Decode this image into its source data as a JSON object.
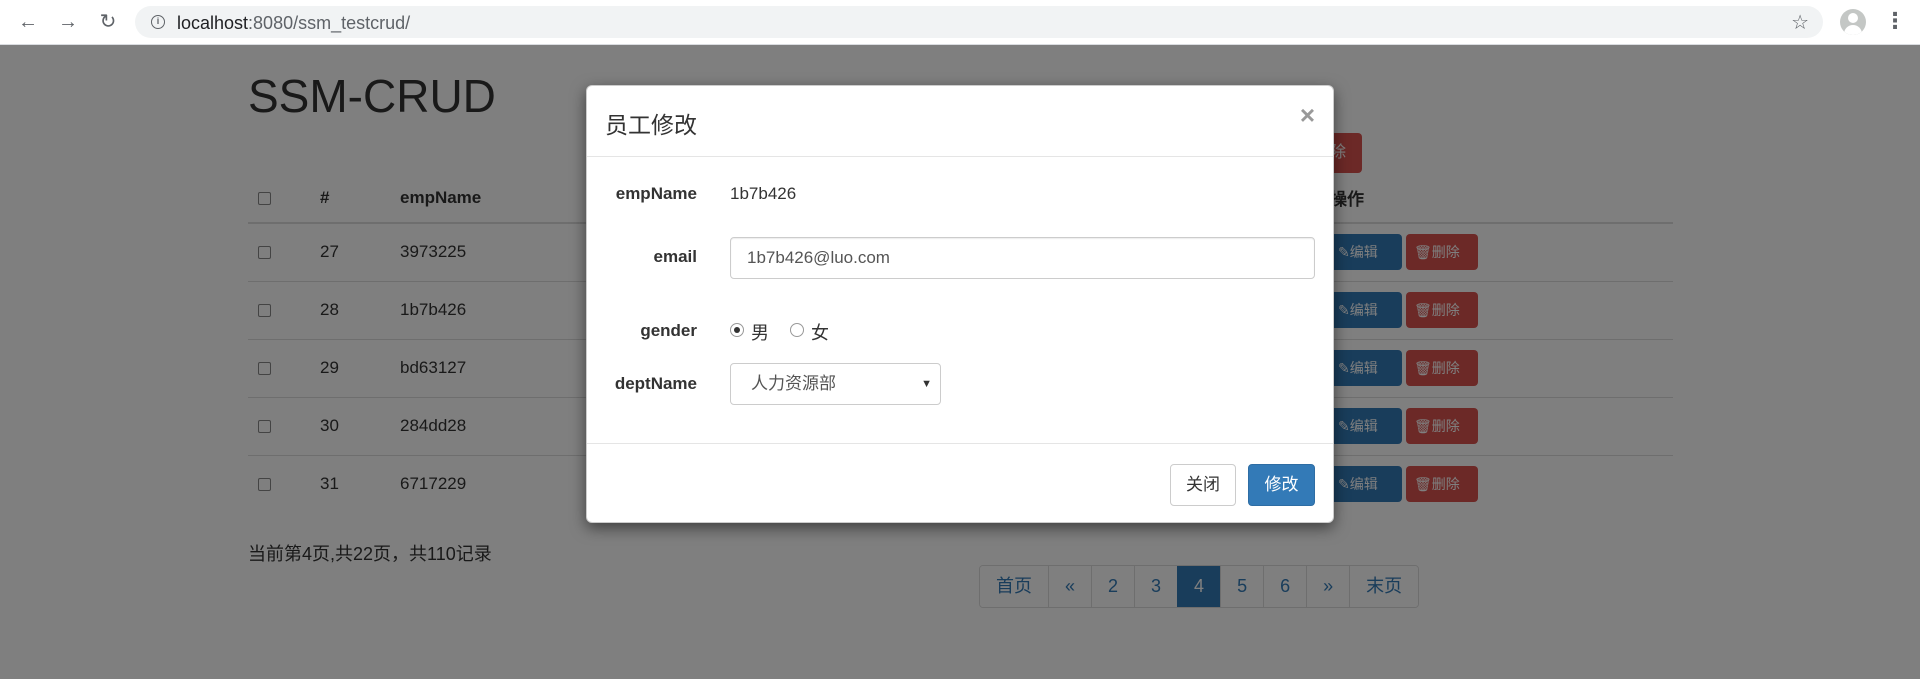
{
  "browser": {
    "url_host": "localhost",
    "url_rest": ":8080/ssm_testcrud/",
    "back_icon": "arrow-left-icon",
    "forward_icon": "arrow-right-icon",
    "reload_icon": "reload-icon"
  },
  "page": {
    "title": "SSM-CRUD",
    "top_delete_label": "除",
    "table": {
      "headers": [
        "#",
        "empName",
        "操作"
      ],
      "rows": [
        {
          "id": "27",
          "name": "3973225"
        },
        {
          "id": "28",
          "name": "1b7b426"
        },
        {
          "id": "29",
          "name": "bd63127"
        },
        {
          "id": "30",
          "name": "284dd28"
        },
        {
          "id": "31",
          "name": "6717229"
        }
      ],
      "edit_label": "编辑",
      "delete_label": "删除"
    },
    "page_info": "当前第4页,共22页，共110记录",
    "pagination": [
      "首页",
      "«",
      "2",
      "3",
      "4",
      "5",
      "6",
      "»",
      "末页"
    ],
    "active_page": "4"
  },
  "modal": {
    "title": "员工修改",
    "close_symbol": "×",
    "labels": {
      "empName": "empName",
      "email": "email",
      "gender": "gender",
      "deptName": "deptName"
    },
    "empName_value": "1b7b426",
    "email_value": "1b7b426@luo.com",
    "gender_options": [
      "男",
      "女"
    ],
    "gender_selected": "男",
    "dept_selected": "人力资源部",
    "close_button": "关闭",
    "save_button": "修改"
  },
  "colors": {
    "primary": "#337ab7",
    "danger": "#d9534f"
  }
}
